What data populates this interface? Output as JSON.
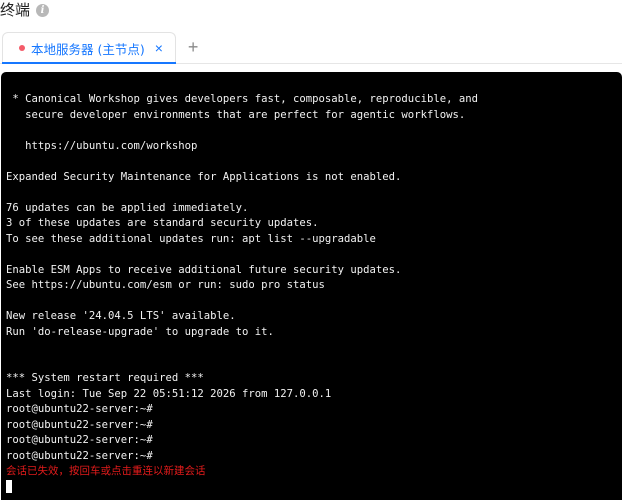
{
  "header": {
    "title": "终端",
    "info_icon": "info-icon"
  },
  "tabs": [
    {
      "label": "本地服务器 (主节点)",
      "status_color": "#f45b69",
      "active": true
    }
  ],
  "tabbar": {
    "add_icon": "plus-icon",
    "close_icon": "close-icon"
  },
  "colors": {
    "accent": "#1677ff",
    "terminal_bg": "#000000",
    "error_text": "#e31b1b"
  },
  "terminal": {
    "lines": [
      " * Canonical Workshop gives developers fast, composable, reproducible, and",
      "   secure developer environments that are perfect for agentic workflows.",
      "",
      "   https://ubuntu.com/workshop",
      "",
      "Expanded Security Maintenance for Applications is not enabled.",
      "",
      "76 updates can be applied immediately.",
      "3 of these updates are standard security updates.",
      "To see these additional updates run: apt list --upgradable",
      "",
      "Enable ESM Apps to receive additional future security updates.",
      "See https://ubuntu.com/esm or run: sudo pro status",
      "",
      "New release '24.04.5 LTS' available.",
      "Run 'do-release-upgrade' to upgrade to it.",
      "",
      "",
      "*** System restart required ***",
      "Last login: Tue Sep 22 05:51:12 2026 from 127.0.0.1",
      "root@ubuntu22-server:~#",
      "root@ubuntu22-server:~#",
      "root@ubuntu22-server:~#",
      "root@ubuntu22-server:~#"
    ],
    "error_message": "会话已失效，按回车或点击重连以新建会话"
  }
}
